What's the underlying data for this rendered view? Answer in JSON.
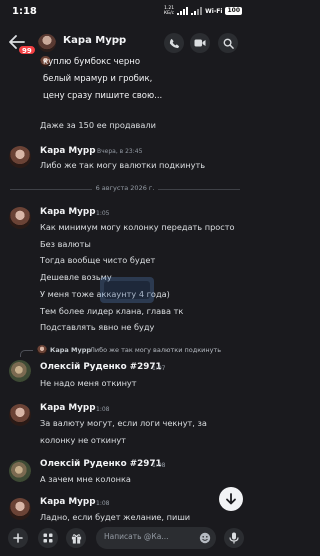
{
  "status_bar": {
    "time": "1:18",
    "network_speed": "1.21",
    "network_unit": "КБ/с",
    "wifi_label": "Wi-Fi",
    "battery": "100"
  },
  "header": {
    "back_badge": "99",
    "name": "Кара Мурр"
  },
  "top_message": {
    "lines": [
      "куплю бумбокс черно",
      "белый мрамур и гробик,",
      "цену сразу пишите свою..."
    ],
    "extra_text": "Даже за 150 ее продавали"
  },
  "messages": [
    {
      "author": "Кара Мурр",
      "timestamp": "Вчера, в 23:45",
      "lines": [
        "Либо же так могу валютки подкинуть"
      ]
    }
  ],
  "date_divider": "6 августа 2026 г.",
  "messages_after": [
    {
      "author": "Кара Мурр",
      "timestamp": "1:05",
      "lines": [
        "Как минимум могу колонку передать просто",
        "Без валюты",
        "Тогда вообще чисто будет",
        "Дешевле возьму",
        "У меня тоже аккаунту 4 года)",
        "Тем более лидер клана, глава тк",
        "Подставлять явно не буду"
      ]
    },
    {
      "reply_to_author": "Кара Мурр",
      "reply_to_text": "Либо же так могу валютки подкинуть",
      "author": "Олексій Руденко #2971",
      "timestamp": "1:07",
      "lines": [
        "Не надо меня откинут"
      ]
    },
    {
      "author": "Кара Мурр",
      "timestamp": "1:08",
      "lines": [
        "За валюту могут, если логи чекнут, за",
        "колонку не откинут"
      ]
    },
    {
      "author": "Олексій Руденко #2971",
      "timestamp": "1:08",
      "lines": [
        "А зачем мне колонка"
      ]
    },
    {
      "author": "Кара Мурр",
      "timestamp": "1:08",
      "lines": [
        "Ладно, если будет желание, пиши"
      ]
    }
  ],
  "composer": {
    "placeholder": "Написать @Ка..."
  },
  "icons": {
    "back": "arrow-left-icon",
    "call": "phone-icon",
    "video": "video-camera-icon",
    "search": "search-icon",
    "scroll_down": "arrow-down-icon",
    "add": "plus-icon",
    "apps": "apps-grid-icon",
    "gift": "gift-icon",
    "emoji": "emoji-icon",
    "mic": "microphone-icon"
  }
}
